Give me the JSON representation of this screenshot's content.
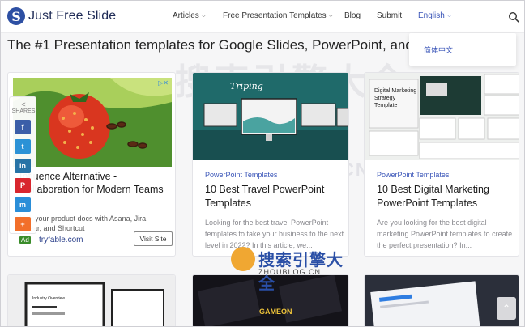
{
  "header": {
    "logo_letter": "S",
    "logo_text": "Just Free Slide",
    "nav": {
      "articles": "Articles",
      "templates": "Free Presentation Templates",
      "blog": "Blog",
      "submit": "Submit",
      "language": "English"
    },
    "language_dropdown": [
      "简体中文"
    ]
  },
  "page_title": "The #1 Presentation templates for Google Slides, PowerPoint, and Keynote",
  "watermark": {
    "chinese": "搜索引擎大全",
    "url": "ZHOUBLOG.CN"
  },
  "ad": {
    "badge": "▷✕",
    "title": "Influence Alternative - Collaboration for Modern Teams",
    "description": "Link your product docs with Asana, Jira, Linear, and Shortcut",
    "ad_mark": "Ad",
    "domain": "tryfable.com",
    "visit_label": "Visit Site"
  },
  "share": {
    "label": "SHARES",
    "buttons": [
      "f",
      "t",
      "in",
      "P",
      "m",
      "+"
    ]
  },
  "cards": [
    {
      "category": "PowerPoint Templates",
      "title": "10 Best Travel PowerPoint Templates",
      "excerpt": "Looking for the best travel PowerPoint templates to take your business to the next level in 2022? In this article, we...",
      "thumb_title": "Triping"
    },
    {
      "category": "PowerPoint Templates",
      "title": "10 Best Digital Marketing PowerPoint Templates",
      "excerpt": "Are you looking for the best digital marketing PowerPoint templates to create the perfect presentation? In...",
      "thumb_title": "Digital Marketing Strategy Template"
    }
  ],
  "bottom_cards": [
    {
      "thumb_text": "Industry Overview"
    },
    {
      "thumb_text": "GAMEON"
    },
    {
      "thumb_text": ""
    }
  ],
  "footer_logo": {
    "chinese": "搜索引擎大全",
    "url": "ZHOUBLOG.CN"
  },
  "colors": {
    "accent": "#3a55b8",
    "brand": "#1f2b56",
    "facebook": "#3b5ea8",
    "twitter": "#2b92d6",
    "linkedin": "#2773a6",
    "pinterest": "#d8262e",
    "messenger": "#2a8ed8",
    "more": "#f26f2a"
  }
}
